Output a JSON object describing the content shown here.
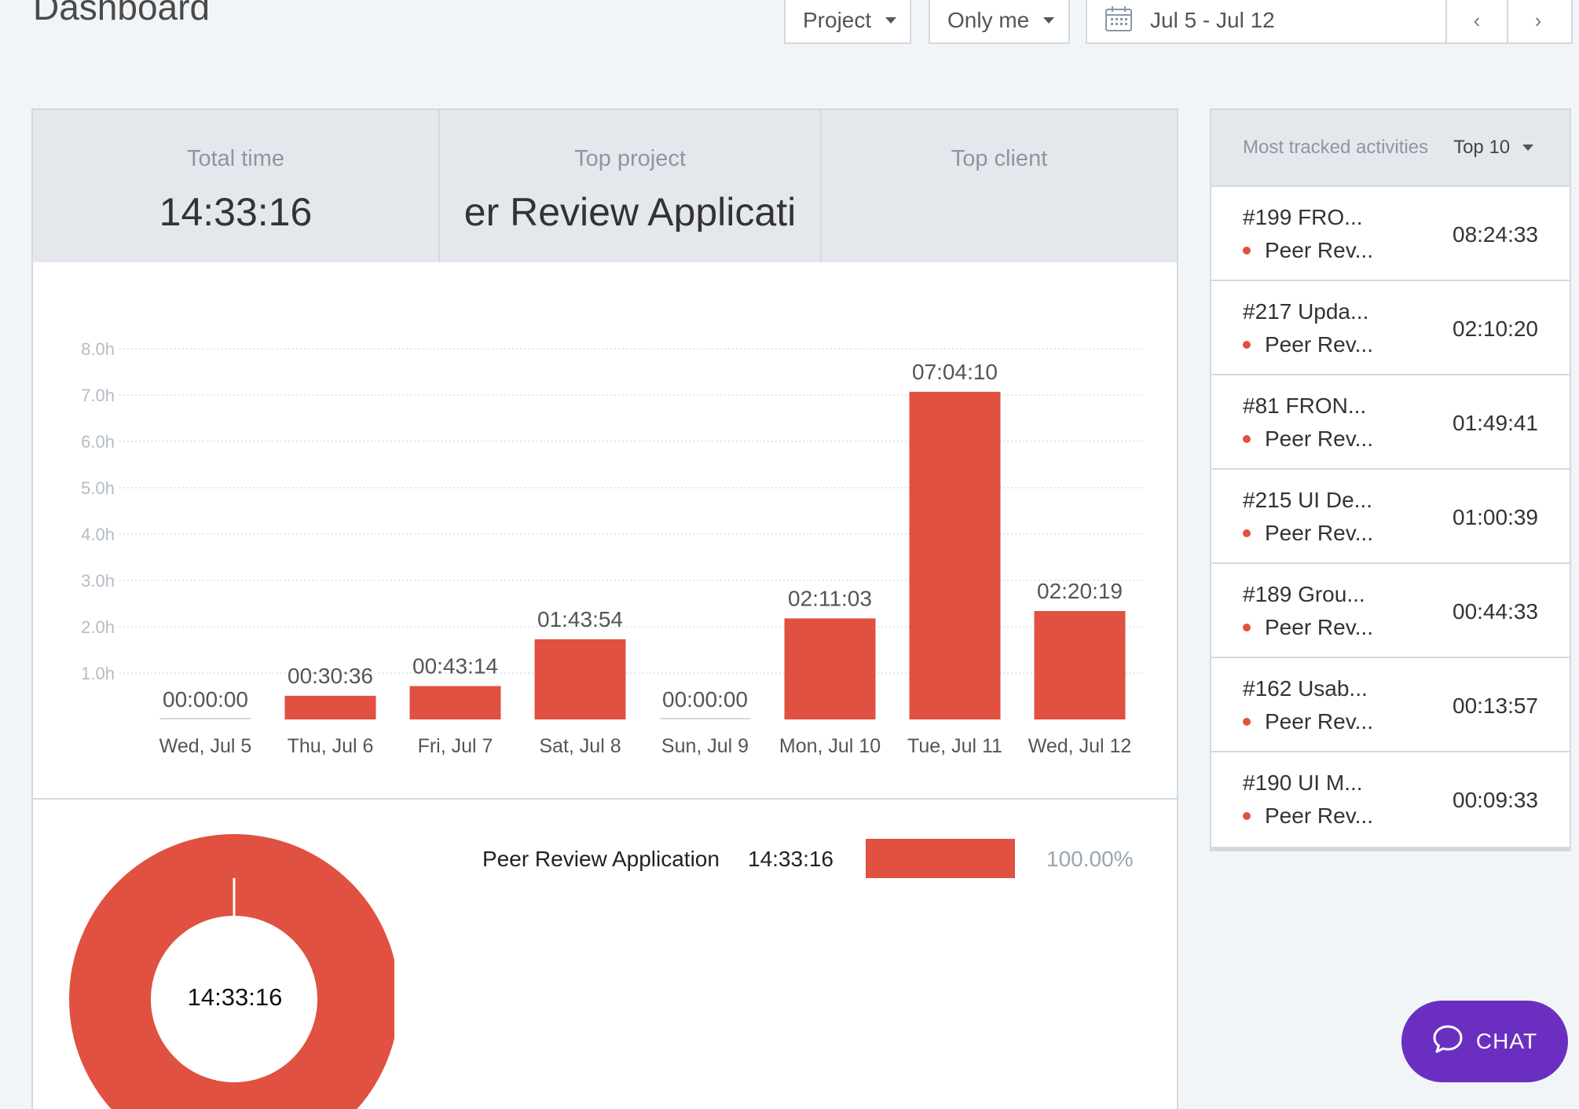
{
  "page": {
    "title": "Dashboard"
  },
  "toolbar": {
    "project_filter": "Project",
    "user_filter": "Only me",
    "date_range": "Jul 5 - Jul 12",
    "prev_icon": "chevron-left-icon",
    "next_icon": "chevron-right-icon",
    "calendar_icon": "calendar-icon"
  },
  "stats": {
    "total_time_label": "Total time",
    "total_time_value": "14:33:16",
    "top_project_label": "Top project",
    "top_project_value": "er Review Applicati",
    "top_client_label": "Top client",
    "top_client_value": ""
  },
  "chart_data": {
    "type": "bar",
    "categories": [
      "Wed, Jul 5",
      "Thu, Jul 6",
      "Fri, Jul 7",
      "Sat, Jul 8",
      "Sun, Jul 9",
      "Mon, Jul 10",
      "Tue, Jul 11",
      "Wed, Jul 12"
    ],
    "values": [
      0,
      0.51,
      0.72,
      1.73,
      0,
      2.18,
      7.07,
      2.34
    ],
    "data_labels": [
      "00:00:00",
      "00:30:36",
      "00:43:14",
      "01:43:54",
      "00:00:00",
      "02:11:03",
      "07:04:10",
      "02:20:19"
    ],
    "y_ticks": [
      "1.0h",
      "2.0h",
      "3.0h",
      "4.0h",
      "5.0h",
      "6.0h",
      "7.0h",
      "8.0h"
    ],
    "ylim": [
      0,
      8
    ],
    "grid": true,
    "bar_color": "#e05141"
  },
  "donut": {
    "center_label": "14:33:16",
    "color": "#e05141",
    "legend": [
      {
        "name": "Peer Review Application",
        "time": "14:33:16",
        "percent": "100.00%",
        "fraction": 1.0
      }
    ]
  },
  "sidebar": {
    "title": "Most tracked activities",
    "top_filter": "Top 10",
    "activities": [
      {
        "title": "#199 FRO...",
        "project": "Peer Rev...",
        "time": "08:24:33"
      },
      {
        "title": "#217 Upda...",
        "project": "Peer Rev...",
        "time": "02:10:20"
      },
      {
        "title": "#81 FRON...",
        "project": "Peer Rev...",
        "time": "01:49:41"
      },
      {
        "title": "#215 UI De...",
        "project": "Peer Rev...",
        "time": "01:00:39"
      },
      {
        "title": "#189 Grou...",
        "project": "Peer Rev...",
        "time": "00:44:33"
      },
      {
        "title": "#162 Usab...",
        "project": "Peer Rev...",
        "time": "00:13:57"
      },
      {
        "title": "#190 UI M...",
        "project": "Peer Rev...",
        "time": "00:09:33"
      }
    ]
  },
  "chat": {
    "label": "CHAT",
    "icon": "chat-bubble-icon"
  }
}
